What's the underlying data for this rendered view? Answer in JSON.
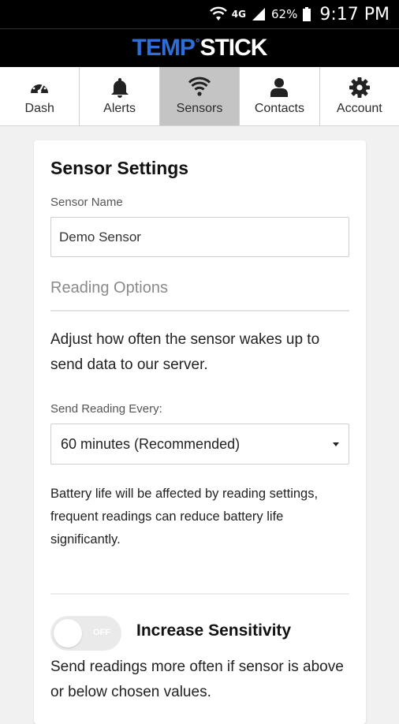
{
  "status_bar": {
    "network": "4G",
    "battery_pct": "62%",
    "time": "9:17 PM"
  },
  "brand": {
    "part1": "TEMP",
    "part2": "STICK",
    "accent_color": "#2d6fd6"
  },
  "nav": {
    "items": [
      {
        "label": "Dash",
        "icon": "dashboard-gauge-icon"
      },
      {
        "label": "Alerts",
        "icon": "bell-icon"
      },
      {
        "label": "Sensors",
        "icon": "wifi-signal-icon",
        "active": true
      },
      {
        "label": "Contacts",
        "icon": "person-icon"
      },
      {
        "label": "Account",
        "icon": "gear-icon"
      }
    ]
  },
  "settings": {
    "title": "Sensor Settings",
    "name_label": "Sensor Name",
    "name_value": "Demo Sensor",
    "reading_options_heading": "Reading Options",
    "reading_options_desc": "Adjust how often the sensor wakes up to send data to our server.",
    "send_every_label": "Send Reading Every:",
    "send_every_value": "60 minutes (Recommended)",
    "battery_note": "Battery life will be affected by reading settings, frequent readings can reduce battery life significantly.",
    "sensitivity_toggle_state": "OFF",
    "sensitivity_title": "Increase Sensitivity",
    "sensitivity_desc": "Send readings more often if sensor is above or below chosen values."
  }
}
